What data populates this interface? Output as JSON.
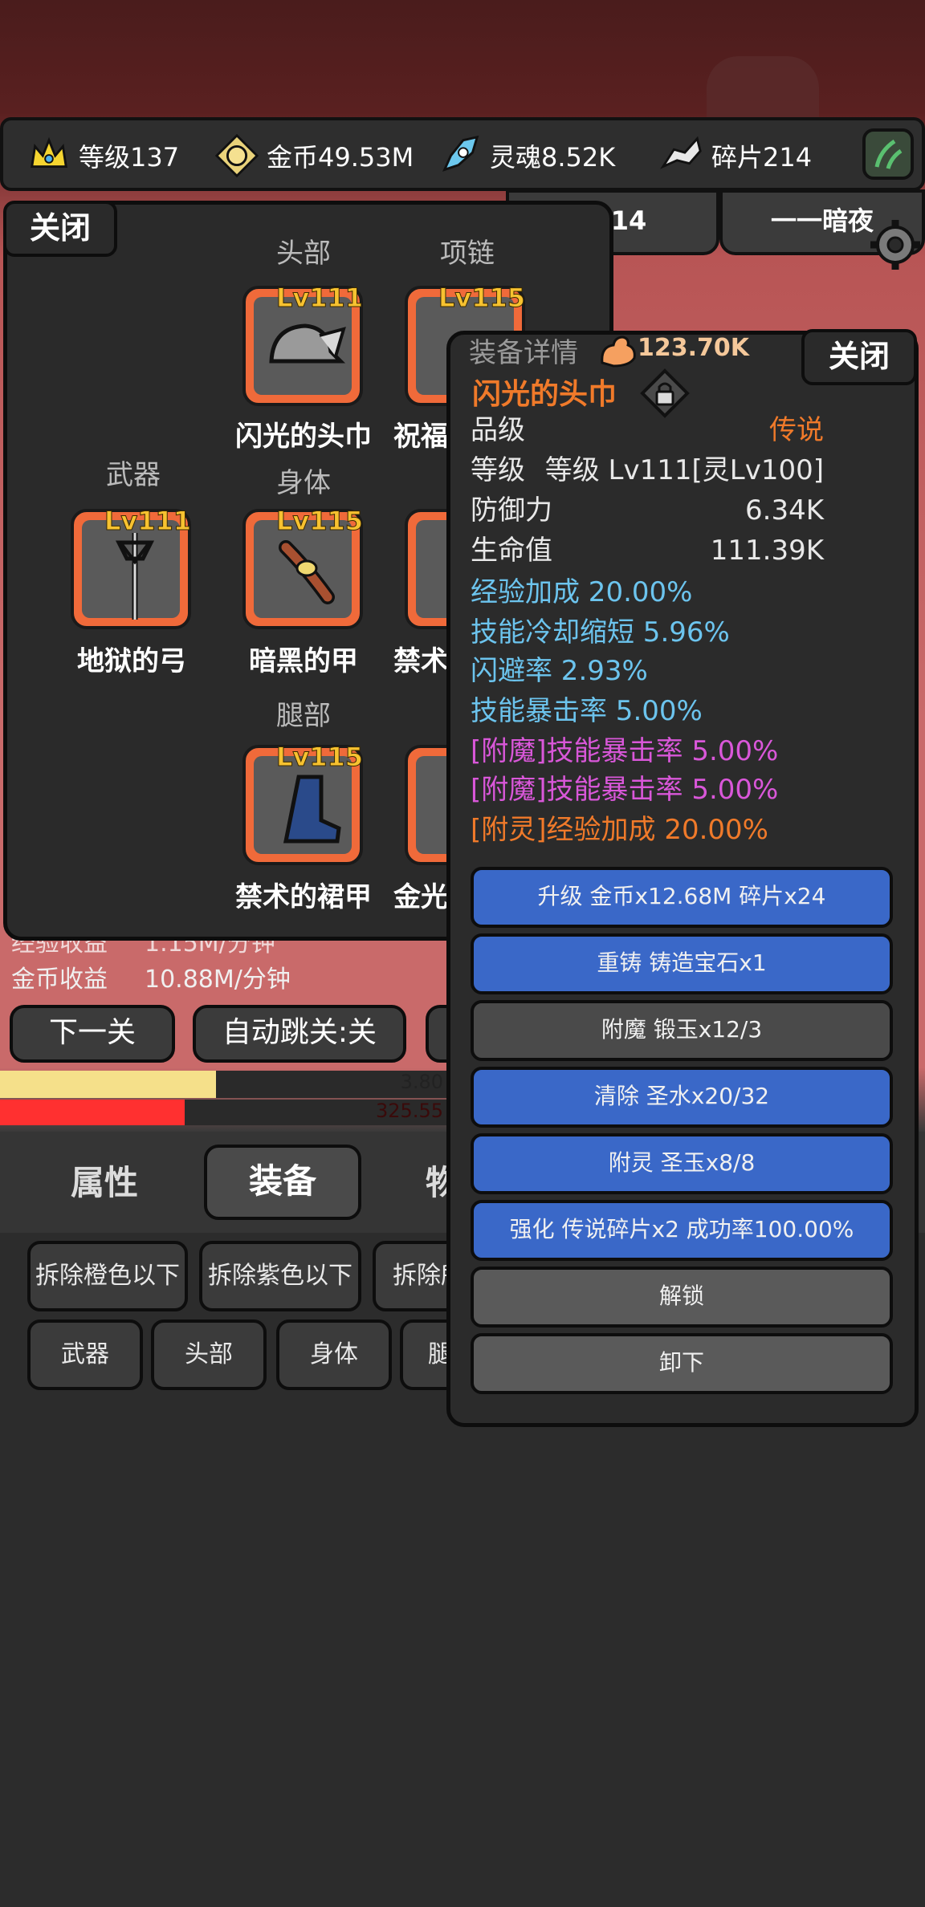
{
  "resources": [
    {
      "icon": "crown-icon",
      "label": "等级137"
    },
    {
      "icon": "gold-coin-icon",
      "label": "金币49.53M"
    },
    {
      "icon": "soul-icon",
      "label": "灵魂8.52K"
    },
    {
      "icon": "shard-icon",
      "label": "碎片214"
    }
  ],
  "bg_tabs": {
    "stage_partial": "14",
    "night_label": "一一暗夜"
  },
  "equip_panel": {
    "close_label": "关闭",
    "slot_labels": {
      "head": "头部",
      "necklace": "项链",
      "weapon": "武器",
      "body": "身体",
      "legs": "腿部"
    },
    "items": [
      {
        "slot": "head",
        "level": "Lv111",
        "name": "闪光的头巾"
      },
      {
        "slot": "necklace",
        "level": "Lv115",
        "name": "祝福"
      },
      {
        "slot": "weapon",
        "level": "Lv111",
        "name": "地狱的弓"
      },
      {
        "slot": "body",
        "level": "Lv115",
        "name": "暗黑的甲"
      },
      {
        "slot": "third_row2",
        "name": "禁术"
      },
      {
        "slot": "legs",
        "level": "Lv115",
        "name": "禁术的裙甲"
      },
      {
        "slot": "third_row3",
        "name": "金光"
      }
    ]
  },
  "info": {
    "exp_income_label": "经验收益",
    "exp_income_value": "1.15M/分钟",
    "gold_income_label": "金币收益",
    "gold_income_value": "10.88M/分钟"
  },
  "controls": {
    "next_stage": "下一关",
    "auto_skip": "自动跳关:关"
  },
  "bars": {
    "yellow_text": "3.80",
    "red_text": "325.55",
    "yellow_fraction": 0.48,
    "red_fraction": 0.41
  },
  "bottom_tabs": {
    "attributes": "属性",
    "equipment": "装备",
    "items_partial": "物"
  },
  "filters": {
    "row1": [
      "拆除橙色以下",
      "拆除紫色以下",
      "拆除所"
    ],
    "row2": [
      "武器",
      "头部",
      "身体",
      "腿"
    ]
  },
  "detail": {
    "header": "装备详情",
    "power": "123.70K",
    "close_label": "关闭",
    "item_name": "闪光的头巾",
    "stats": [
      {
        "label": "品级",
        "value": "传说"
      },
      {
        "label": "等级",
        "value": "等级 Lv111[灵Lv100]"
      },
      {
        "label": "防御力",
        "value": "6.34K"
      },
      {
        "label": "生命值",
        "value": "111.39K"
      }
    ],
    "affixes": [
      {
        "text": "经验加成 20.00%",
        "color": "#6cc4ee"
      },
      {
        "text": "技能冷却缩短 5.96%",
        "color": "#6cc4ee"
      },
      {
        "text": "闪避率 2.93%",
        "color": "#6cc4ee"
      },
      {
        "text": "技能暴击率 5.00%",
        "color": "#6cc4ee"
      },
      {
        "text": "[附魔]技能暴击率 5.00%",
        "color": "#d957d9"
      },
      {
        "text": "[附魔]技能暴击率 5.00%",
        "color": "#d957d9"
      },
      {
        "text": "[附灵]经验加成 20.00%",
        "color": "#f07a2a"
      }
    ],
    "actions": [
      {
        "label": "升级 金币x12.68M 碎片x24",
        "style": "blue"
      },
      {
        "label": "重铸 铸造宝石x1",
        "style": "blue"
      },
      {
        "label": "附魔 锻玉x12/3",
        "style": "dark"
      },
      {
        "label": "清除 圣水x20/32",
        "style": "blue"
      },
      {
        "label": "附灵 圣玉x8/8",
        "style": "blue"
      },
      {
        "label": "强化 传说碎片x2 成功率100.00%",
        "style": "blue"
      },
      {
        "label": "解锁",
        "style": "grey"
      },
      {
        "label": "卸下",
        "style": "grey"
      }
    ]
  },
  "colors": {
    "legendary": "#f07a2a",
    "button_blue": "#3a68c8",
    "level_gold": "#f7c230"
  }
}
